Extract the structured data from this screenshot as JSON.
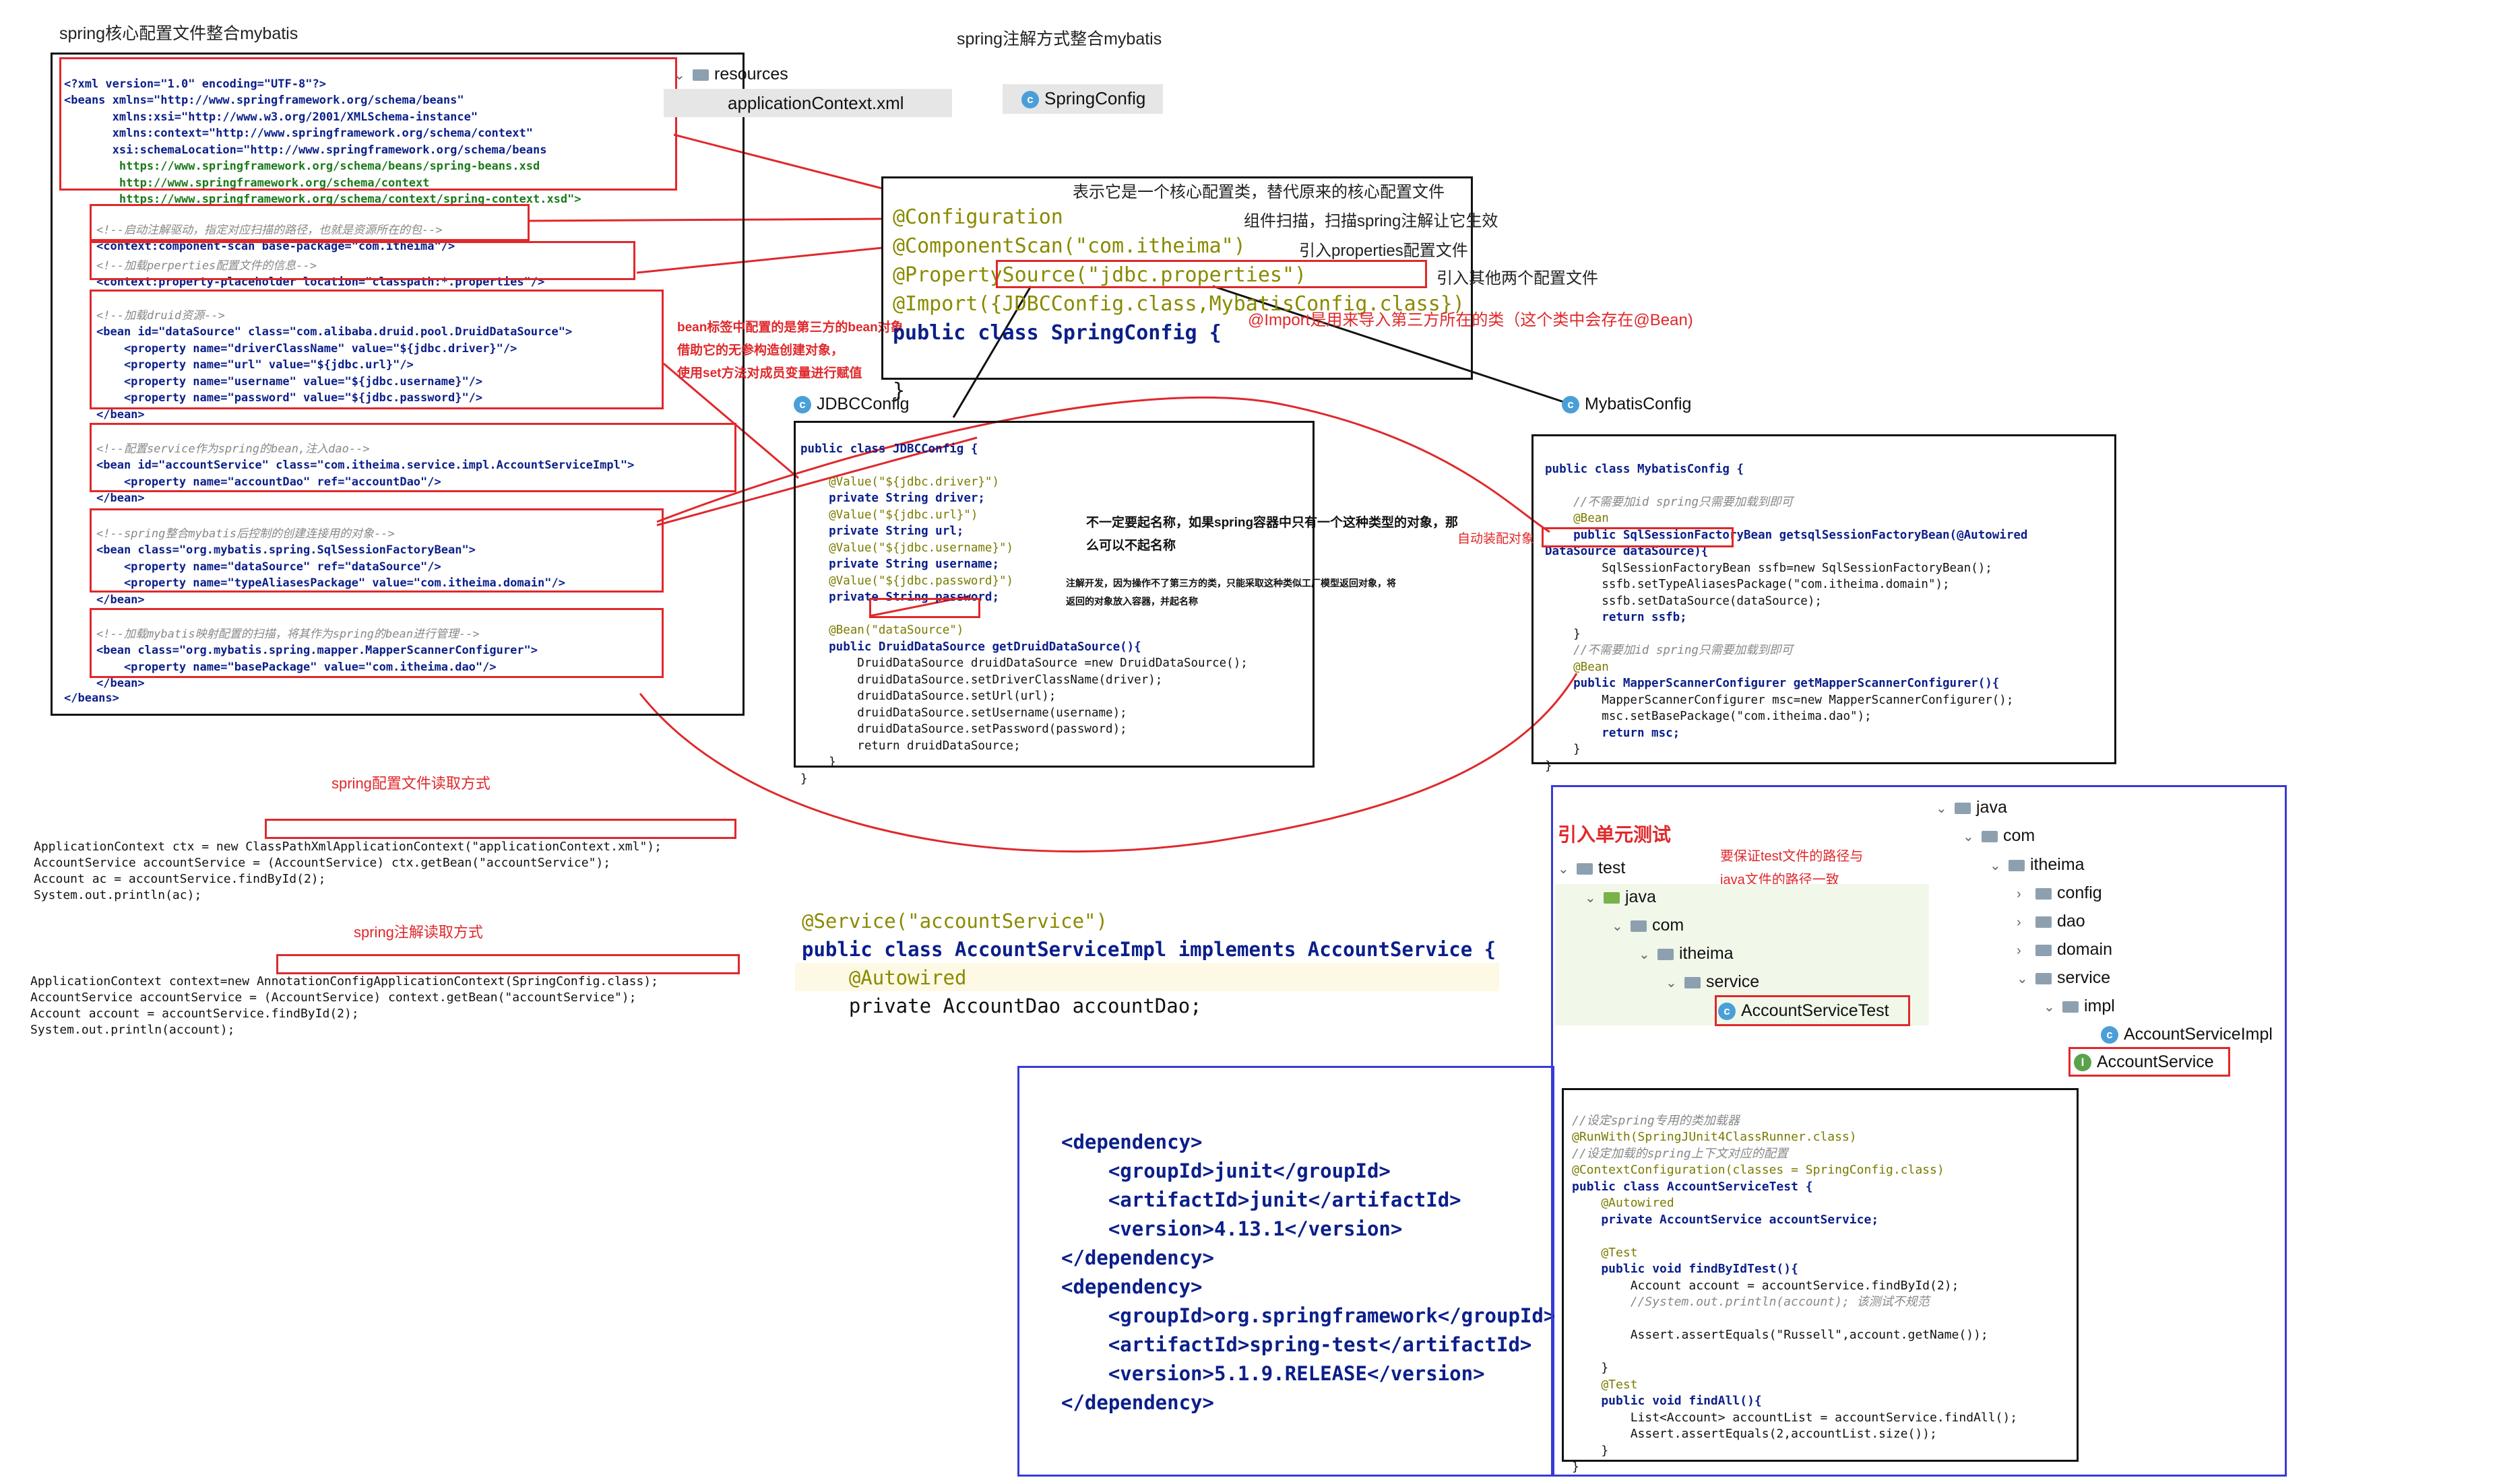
{
  "titles": {
    "spring_xml": "spring核心配置文件整合mybatis",
    "spring_anno": "spring注解方式整合mybatis",
    "xml_read": "spring配置文件读取方式",
    "anno_read": "spring注解读取方式",
    "unit_test": "引入单元测试"
  },
  "tabs": {
    "resources": "resources",
    "appctx": "applicationContext.xml",
    "springconfig": "SpringConfig",
    "jdbcconfig": "JDBCConfig",
    "mybatisconfig": "MybatisConfig"
  },
  "xml": {
    "header": [
      "<?xml version=\"1.0\" encoding=\"UTF-8\"?>",
      "<beans xmlns=\"http://www.springframework.org/schema/beans\"",
      "       xmlns:xsi=\"http://www.w3.org/2001/XMLSchema-instance\"",
      "       xmlns:context=\"http://www.springframework.org/schema/context\"",
      "       xsi:schemaLocation=\"http://www.springframework.org/schema/beans",
      "        https://www.springframework.org/schema/beans/spring-beans.xsd",
      "        http://www.springframework.org/schema/context",
      "        https://www.springframework.org/schema/context/spring-context.xsd\">"
    ],
    "scan_comment": "<!--启动注解驱动，指定对应扫描的路径，也就是资源所在的包-->",
    "scan": "<context:component-scan base-package=\"com.itheima\"/>",
    "prop_comment": "<!--加载perperties配置文件的信息-->",
    "prop": "<context:property-placeholder location=\"classpath:*.properties\"/>",
    "druid_comment": "<!--加载druid资源-->",
    "druid": [
      "<bean id=\"dataSource\" class=\"com.alibaba.druid.pool.DruidDataSource\">",
      "    <property name=\"driverClassName\" value=\"${jdbc.driver}\"/>",
      "    <property name=\"url\" value=\"${jdbc.url}\"/>",
      "    <property name=\"username\" value=\"${jdbc.username}\"/>",
      "    <property name=\"password\" value=\"${jdbc.password}\"/>",
      "</bean>"
    ],
    "service_comment": "<!--配置service作为spring的bean,注入dao-->",
    "service": [
      "<bean id=\"accountService\" class=\"com.itheima.service.impl.AccountServiceImpl\">",
      "    <property name=\"accountDao\" ref=\"accountDao\"/>",
      "</bean>"
    ],
    "factory_comment": "<!--spring整合mybatis后控制的创建连接用的对象-->",
    "factory": [
      "<bean class=\"org.mybatis.spring.SqlSessionFactoryBean\">",
      "    <property name=\"dataSource\" ref=\"dataSource\"/>",
      "    <property name=\"typeAliasesPackage\" value=\"com.itheima.domain\"/>",
      "</bean>"
    ],
    "mapper_comment": "<!--加载mybatis映射配置的扫描，将其作为spring的bean进行管理-->",
    "mapper": [
      "<bean class=\"org.mybatis.spring.mapper.MapperScannerConfigurer\">",
      "    <property name=\"basePackage\" value=\"com.itheima.dao\"/>",
      "</bean>"
    ],
    "end": "</beans>"
  },
  "springconfig": {
    "l1": "@Configuration",
    "l1_note": "表示它是一个核心配置类，替代原来的核心配置文件",
    "l2": "@ComponentScan(\"com.itheima\")",
    "l2_note": "组件扫描，扫描spring注解让它生效",
    "l3": "@PropertySource(\"jdbc.properties\")",
    "l3_note": "引入properties配置文件",
    "l4": "@Import({JDBCConfig.class,MybatisConfig.class})",
    "l4_note": "引入其他两个配置文件",
    "l5": "public class SpringConfig {",
    "l6": "}",
    "import_note": "@Import是用来导入第三方所在的类（这个类中会存在@Bean)"
  },
  "jdbc": {
    "lines": [
      "public class JDBCConfig {",
      "",
      "    @Value(\"${jdbc.driver}\")",
      "    private String driver;",
      "    @Value(\"${jdbc.url}\")",
      "    private String url;",
      "    @Value(\"${jdbc.username}\")",
      "    private String username;",
      "    @Value(\"${jdbc.password}\")",
      "    private String password;",
      "",
      "    @Bean(\"dataSource\")",
      "    public DruidDataSource getDruidDataSource(){",
      "        DruidDataSource druidDataSource =new DruidDataSource();",
      "        druidDataSource.setDriverClassName(driver);",
      "        druidDataSource.setUrl(url);",
      "        druidDataSource.setUsername(username);",
      "        druidDataSource.setPassword(password);",
      "        return druidDataSource;",
      "    }",
      "}"
    ],
    "note1": "不一定要起名称，如果spring容器中只有一个这种类型的对象，那",
    "note2": "么可以不起名称",
    "note3": "注解开发，因为操作不了第三方的类，只能采取这种类似工厂模型返回对象，将",
    "note4": "返回的对象放入容器，并起名称"
  },
  "bean_note": [
    "bean标签中配置的是第三方的bean对象",
    "借助它的无参构造创建对象，",
    "使用set方法对成员变量进行赋值"
  ],
  "autowire_note": "自动装配对象",
  "mybatis": {
    "lines": [
      "public class MybatisConfig {",
      "",
      "    //不需要加id spring只需要加载到即可",
      "    @Bean",
      "    public SqlSessionFactoryBean getsqlSessionFactoryBean(@Autowired",
      "DataSource dataSource){",
      "        SqlSessionFactoryBean ssfb=new SqlSessionFactoryBean();",
      "        ssfb.setTypeAliasesPackage(\"com.itheima.domain\");",
      "        ssfb.setDataSource(dataSource);",
      "        return ssfb;",
      "    }",
      "    //不需要加id spring只需要加载到即可",
      "    @Bean",
      "    public MapperScannerConfigurer getMapperScannerConfigurer(){",
      "        MapperScannerConfigurer msc=new MapperScannerConfigurer();",
      "        msc.setBasePackage(\"com.itheima.dao\");",
      "        return msc;",
      "    }",
      "}"
    ]
  },
  "xml_read_code": [
    "ApplicationContext ctx = new ClassPathXmlApplicationContext(\"applicationContext.xml\");",
    "AccountService accountService = (AccountService) ctx.getBean(\"accountService\");",
    "Account ac = accountService.findById(2);",
    "System.out.println(ac);"
  ],
  "anno_read_code": [
    "ApplicationContext context=new AnnotationConfigApplicationContext(SpringConfig.class);",
    "AccountService accountService = (AccountService) context.getBean(\"accountService\");",
    "Account account = accountService.findById(2);",
    "System.out.println(account);"
  ],
  "service_impl": [
    "@Service(\"accountService\")",
    "public class AccountServiceImpl implements AccountService {",
    "    @Autowired",
    "    private AccountDao accountDao;"
  ],
  "dependencies": [
    "<dependency>",
    "    <groupId>junit</groupId>",
    "    <artifactId>junit</artifactId>",
    "    <version>4.13.1</version>",
    "</dependency>",
    "<dependency>",
    "    <groupId>org.springframework</groupId>",
    "    <artifactId>spring-test</artifactId>",
    "    <version>5.1.9.RELEASE</version>",
    "</dependency>"
  ],
  "test_note": [
    "要保证test文件的路径与",
    "java文件的路径一致"
  ],
  "test_tree": [
    "test",
    "java",
    "com",
    "itheima",
    "service",
    "AccountServiceTest"
  ],
  "main_tree": [
    "java",
    "com",
    "itheima",
    "config",
    "dao",
    "domain",
    "service",
    "impl",
    "AccountServiceImpl",
    "AccountService"
  ],
  "test_code": [
    "//设定spring专用的类加载器",
    "@RunWith(SpringJUnit4ClassRunner.class)",
    "//设定加载的spring上下文对应的配置",
    "@ContextConfiguration(classes = SpringConfig.class)",
    "public class AccountServiceTest {",
    "    @Autowired",
    "    private AccountService accountService;",
    "",
    "    @Test",
    "    public void findByIdTest(){",
    "        Account account = accountService.findById(2);",
    "        //System.out.println(account); 该测试不规范",
    "",
    "        Assert.assertEquals(\"Russell\",account.getName());",
    "",
    "    }",
    "    @Test",
    "    public void findAll(){",
    "        List<Account> accountList = accountService.findAll();",
    "        Assert.assertEquals(2,accountList.size());",
    "    }",
    "}"
  ]
}
